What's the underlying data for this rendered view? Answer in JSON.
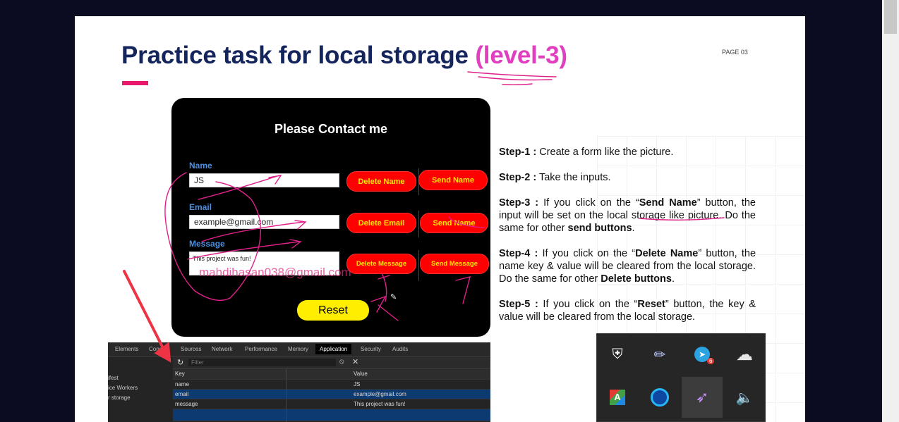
{
  "slide": {
    "title_main": "Practice task for local storage",
    "title_level": "(level-3)",
    "page_label": "PAGE 03"
  },
  "form": {
    "title": "Please Contact me",
    "name_label": "Name",
    "name_value": "JS",
    "email_label": "Email",
    "email_value": "example@gmail.com",
    "message_label": "Message",
    "message_value": "This project was fun!",
    "delete_name": "Delete Name",
    "send_name": "Send Name",
    "delete_email": "Delete Email",
    "send_email": "Send Name",
    "delete_message": "Delete Message",
    "send_message": "Send Message",
    "reset": "Reset",
    "watermark": "mahdihasan038@gmail.com"
  },
  "steps": [
    {
      "label": "Step-1 :",
      "parts": [
        " Create a form like the picture."
      ]
    },
    {
      "label": "Step-2 :",
      "parts": [
        " Take the inputs."
      ]
    },
    {
      "label": "Step-3 :",
      "parts": [
        " If you click on the “",
        "Send Name",
        "” button, the input will be set on the local storage like picture. Do the same for other ",
        "send buttons",
        "."
      ]
    },
    {
      "label": "Step-4 :",
      "parts": [
        " If you click on the “",
        "Delete Name",
        "” button, the name key & value will be cleared from the local storage. Do the same for other ",
        "Delete buttons",
        "."
      ]
    },
    {
      "label": "Step-5 :",
      "parts": [
        " If you click on the “",
        "Reset",
        "” button, the key & value will be cleared from the local storage."
      ]
    }
  ],
  "devtools": {
    "tabs": [
      "Elements",
      "Conso",
      "Sources",
      "Network",
      "Performance",
      "Memory",
      "Application",
      "Security",
      "Audits"
    ],
    "active_tab": "Application",
    "sidebar": [
      "ifest",
      "ice Workers",
      "r storage"
    ],
    "filter_placeholder": "Filter",
    "columns": [
      "Key",
      "Value"
    ],
    "rows": [
      {
        "key": "name",
        "value": "JS"
      },
      {
        "key": "email",
        "value": "example@gmail.com"
      },
      {
        "key": "message",
        "value": "This project was fun!"
      }
    ]
  },
  "tray": {
    "icons": [
      "windows-security-warning-icon",
      "pencil-app-icon",
      "telegram-icon",
      "onedrive-icon",
      "color-grid-app-icon",
      "ring-app-icon",
      "feather-pen-app-icon",
      "speaker-icon"
    ],
    "telegram_badge": "6"
  },
  "colors": {
    "title": "#14245c",
    "accent_pink": "#e040c0",
    "button_red": "#ff0000",
    "button_text": "#ffe600",
    "reset_yellow": "#ffee00",
    "label_blue": "#4b8fe0",
    "annotation": "#e0208a"
  }
}
